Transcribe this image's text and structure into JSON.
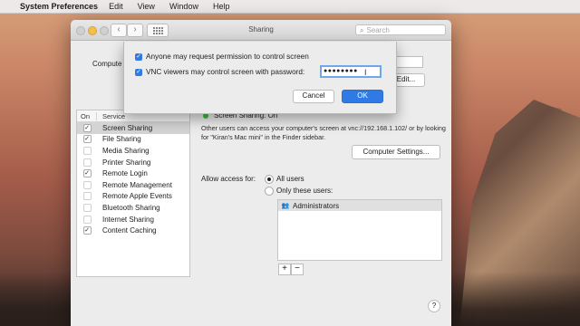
{
  "menubar": {
    "app": "System Preferences",
    "items": [
      "Edit",
      "View",
      "Window",
      "Help"
    ]
  },
  "window": {
    "title": "Sharing",
    "search_placeholder": "Search",
    "computer_name_label": "Compute",
    "edit_label": "Edit..."
  },
  "services": {
    "col_on": "On",
    "col_service": "Service",
    "items": [
      {
        "label": "Screen Sharing",
        "checked": true,
        "selected": true
      },
      {
        "label": "File Sharing",
        "checked": true
      },
      {
        "label": "Media Sharing",
        "checked": false
      },
      {
        "label": "Printer Sharing",
        "checked": false
      },
      {
        "label": "Remote Login",
        "checked": true
      },
      {
        "label": "Remote Management",
        "checked": false
      },
      {
        "label": "Remote Apple Events",
        "checked": false
      },
      {
        "label": "Bluetooth Sharing",
        "checked": false
      },
      {
        "label": "Internet Sharing",
        "checked": false
      },
      {
        "label": "Content Caching",
        "checked": true
      }
    ]
  },
  "pane": {
    "status": "Screen Sharing: On",
    "description": "Other users can access your computer's screen at vnc://192.168.1.102/ or by looking for \"Kiran's Mac mini\" in the Finder sidebar.",
    "computer_settings": "Computer Settings...",
    "allow_label": "Allow access for:",
    "all_users": "All users",
    "only_these": "Only these users:",
    "users": [
      "Administrators"
    ],
    "plus": "+",
    "minus": "−",
    "help": "?"
  },
  "sheet": {
    "opt1": "Anyone may request permission to control screen",
    "opt2": "VNC viewers may control screen with password:",
    "password": "●●●●●●●●",
    "cancel": "Cancel",
    "ok": "OK"
  }
}
